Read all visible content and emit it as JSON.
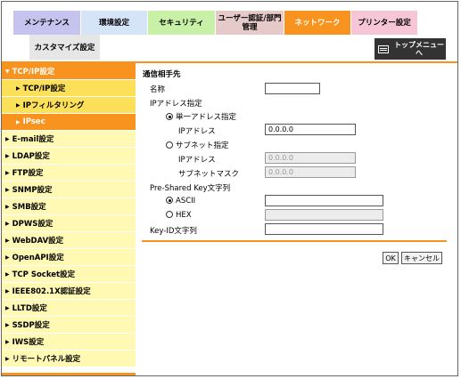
{
  "tabs": [
    {
      "label": "メンテナンス",
      "color": "#c6c3ee",
      "width": 76
    },
    {
      "label": "環境設定",
      "color": "#d6e4f7",
      "width": 75
    },
    {
      "label": "セキュリティ",
      "color": "#c8f0a6",
      "width": 76
    },
    {
      "label": "ユーザー認証/部門\n管理",
      "color": "#e6c9c9",
      "width": 77
    },
    {
      "label": "ネットワーク",
      "color": "#f7931e",
      "width": 75
    },
    {
      "label": "プリンター設定",
      "color": "#f7c6d6",
      "width": 75
    }
  ],
  "subtab": {
    "label": "カスタマイズ設定"
  },
  "top_menu": {
    "label": "トップメニュー\nへ"
  },
  "sidebar": {
    "tcpip": "TCP/IP設定",
    "children": [
      "TCP/IP設定",
      "IPフィルタリング",
      "IPsec"
    ],
    "items": [
      "E-mail設定",
      "LDAP設定",
      "FTP設定",
      "SNMP設定",
      "SMB設定",
      "DPWS設定",
      "WebDAV設定",
      "OpenAPI設定",
      "TCP Socket設定",
      "IEEE802.1X認証設定",
      "LLTD設定",
      "SSDP設定",
      "IWS設定",
      "リモートパネル設定"
    ]
  },
  "form": {
    "section_title": "通信相手先",
    "name_label": "名称",
    "name_value": "",
    "ip_spec_label": "IPアドレス指定",
    "single_label": "単一アドレス指定",
    "ip_label": "IPアドレス",
    "ip_value": "0.0.0.0",
    "subnet_label": "サブネット指定",
    "subnet_ip_label": "IPアドレス",
    "subnet_ip_value": "0.0.0.0",
    "subnet_mask_label": "サブネットマスク",
    "subnet_mask_value": "0.0.0.0",
    "psk_label": "Pre-Shared Key文字列",
    "ascii_label": "ASCII",
    "ascii_value": "",
    "hex_label": "HEX",
    "hex_value": "",
    "keyid_label": "Key-ID文字列",
    "keyid_value": ""
  },
  "buttons": {
    "ok": "OK",
    "cancel": "キャンセル"
  }
}
